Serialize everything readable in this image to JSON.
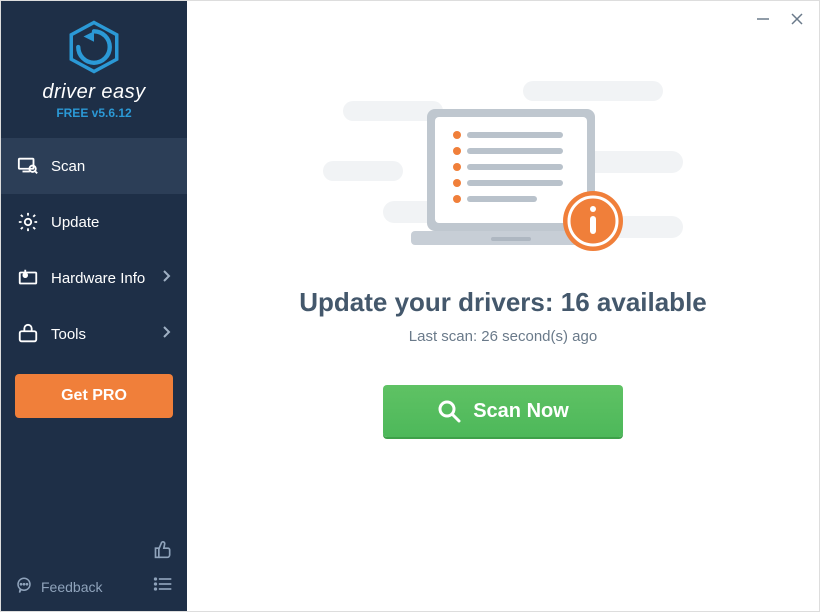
{
  "brand": {
    "name": "driver easy",
    "version": "FREE v5.6.12"
  },
  "sidebar": {
    "items": [
      {
        "label": "Scan"
      },
      {
        "label": "Update"
      },
      {
        "label": "Hardware Info"
      },
      {
        "label": "Tools"
      }
    ],
    "get_pro_label": "Get PRO",
    "feedback_label": "Feedback"
  },
  "main": {
    "headline_prefix": "Update your drivers: ",
    "available_count": "16",
    "headline_suffix": " available",
    "last_scan": "Last scan: 26 second(s) ago",
    "scan_button": "Scan Now"
  },
  "colors": {
    "sidebar_bg": "#1e2f47",
    "accent_orange": "#f07f3a",
    "accent_green": "#4db85a",
    "logo_blue": "#2b99d6"
  }
}
